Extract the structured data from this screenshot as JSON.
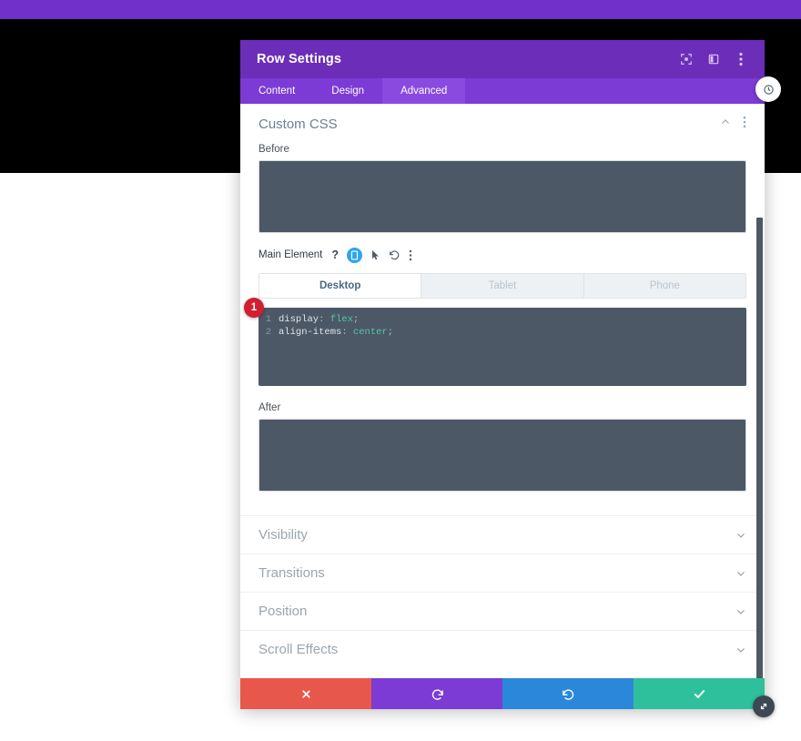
{
  "window": {
    "title": "Row Settings",
    "header_icons": [
      "fullscreen-icon",
      "split-view-icon",
      "more-options-icon"
    ]
  },
  "tabs": [
    {
      "label": "Content",
      "active": false
    },
    {
      "label": "Design",
      "active": false
    },
    {
      "label": "Advanced",
      "active": true
    }
  ],
  "section": {
    "title": "Custom CSS",
    "collapse_icon": "chevron-up-icon",
    "more_icon": "more-options-icon"
  },
  "fields": {
    "before_label": "Before",
    "before_value": "",
    "after_label": "After",
    "after_value": "",
    "main_element_label": "Main Element",
    "main_element_icons": [
      "help-icon",
      "responsive-icon",
      "hover-pointer-icon",
      "reset-icon",
      "more-options-icon"
    ]
  },
  "device_tabs": [
    {
      "label": "Desktop",
      "active": true
    },
    {
      "label": "Tablet",
      "active": false
    },
    {
      "label": "Phone",
      "active": false
    }
  ],
  "code_editor": {
    "badge": "1",
    "lines": [
      {
        "number": "1",
        "property": "display",
        "value": "flex"
      },
      {
        "number": "2",
        "property": "align-items",
        "value": "center"
      }
    ]
  },
  "collapsed_sections": [
    {
      "label": "Visibility",
      "icon": "chevron-down-icon"
    },
    {
      "label": "Transitions",
      "icon": "chevron-down-icon"
    },
    {
      "label": "Position",
      "icon": "chevron-down-icon"
    },
    {
      "label": "Scroll Effects",
      "icon": "chevron-down-icon"
    }
  ],
  "footer_buttons": [
    {
      "name": "cancel",
      "icon": "close-icon"
    },
    {
      "name": "undo",
      "icon": "undo-icon"
    },
    {
      "name": "redo",
      "icon": "redo-icon"
    },
    {
      "name": "save",
      "icon": "check-icon"
    }
  ],
  "floating": {
    "top_button_icon": "settings-gear-icon",
    "resize_button_icon": "resize-diagonal-icon"
  },
  "colors": {
    "brand_purple": "#6c2eb9",
    "tab_purple": "#7c3bd4",
    "tab_active_purple": "#8a4ae0",
    "editor_bg": "#4c5866",
    "badge_red": "#d11f2f",
    "cancel_red": "#e8574c",
    "redo_blue": "#2b87d9",
    "save_green": "#2ec09c",
    "accent_blue": "#2ea3f2",
    "code_value_green": "#53c8a8"
  }
}
